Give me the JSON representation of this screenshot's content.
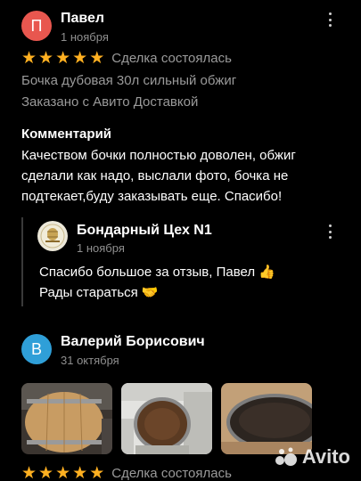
{
  "reviews": [
    {
      "avatar_letter": "П",
      "avatar_color": "#e8574f",
      "name": "Павел",
      "date": "1 ноября",
      "rating": 5,
      "deal_status": "Сделка состоялась",
      "product": "Бочка дубовая 30л сильный обжиг",
      "delivery": "Заказано с Авито Доставкой",
      "comment_title": "Комментарий",
      "comment": "Качеством бочки полностью доволен, обжиг сделали как надо, выслали фото, бочка не подтекает,буду заказывать еще. Спасибо!",
      "reply": {
        "seller_name": "Бондарный Цех N1",
        "date": "1 ноября",
        "line1": "Спасибо большое за отзыв, Павел 👍",
        "line2": "Рады стараться 🤝"
      }
    },
    {
      "avatar_letter": "В",
      "avatar_color": "#2f9fd8",
      "name": "Валерий Борисович",
      "date": "31 октября",
      "rating": 5,
      "deal_status": "Сделка состоялась",
      "photos": [
        "barrel-photo-1",
        "barrel-photo-2",
        "barrel-lid-photo"
      ]
    }
  ],
  "watermark": "Avito",
  "accent": {
    "star": "#ffb021"
  }
}
